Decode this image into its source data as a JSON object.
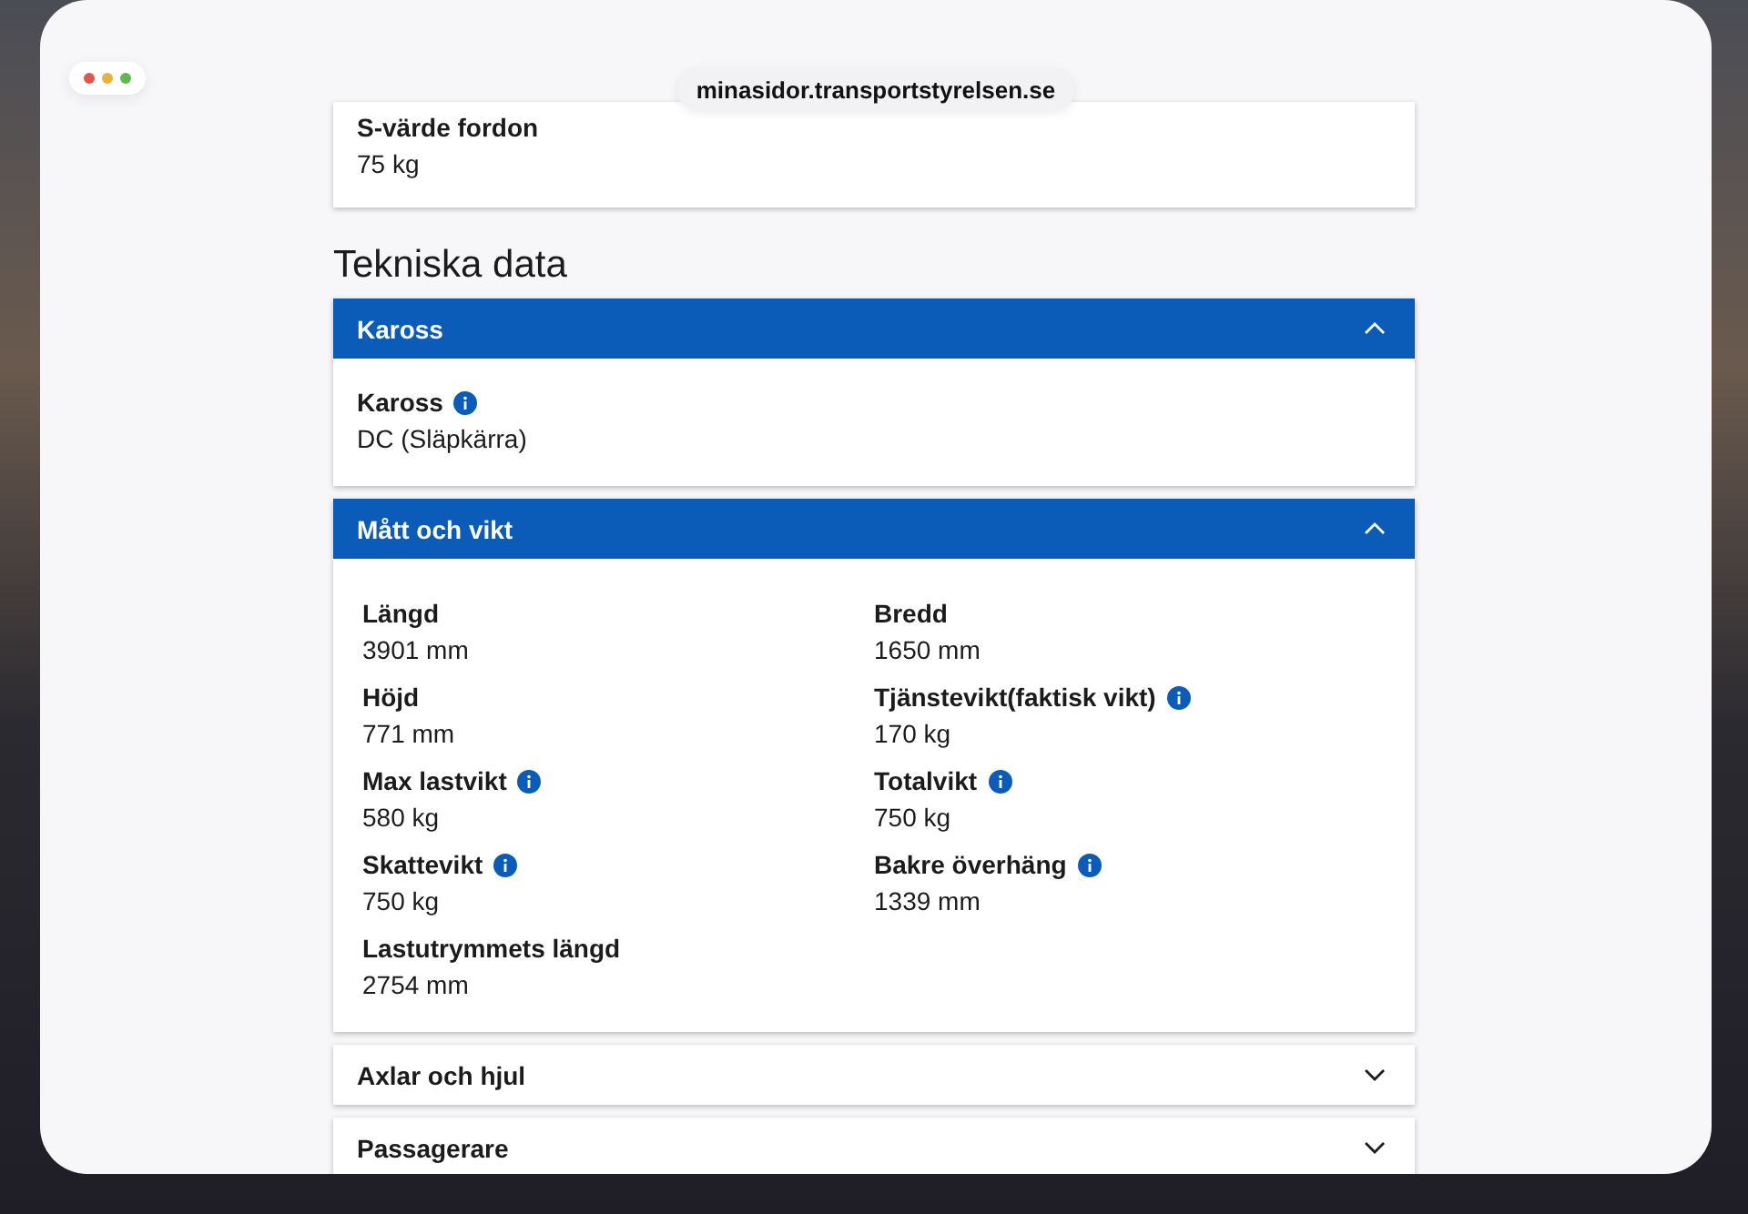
{
  "browser": {
    "url": "minasidor.transportstyrelsen.se"
  },
  "top_card": {
    "label": "S-värde fordon",
    "value": "75 kg"
  },
  "heading": "Tekniska data",
  "sections": [
    {
      "title": "Kaross",
      "expanded": true,
      "fields": [
        {
          "label": "Kaross",
          "info": true,
          "value": "DC (Släpkärra)"
        }
      ]
    },
    {
      "title": "Mått och vikt",
      "expanded": true,
      "fields": [
        {
          "label": "Längd",
          "info": false,
          "value": "3901 mm"
        },
        {
          "label": "Bredd",
          "info": false,
          "value": "1650 mm"
        },
        {
          "label": "Höjd",
          "info": false,
          "value": "771 mm"
        },
        {
          "label": "Tjänstevikt(faktisk vikt)",
          "info": true,
          "value": "170 kg"
        },
        {
          "label": "Max lastvikt",
          "info": true,
          "value": "580 kg"
        },
        {
          "label": "Totalvikt",
          "info": true,
          "value": "750 kg"
        },
        {
          "label": "Skattevikt",
          "info": true,
          "value": "750 kg"
        },
        {
          "label": "Bakre överhäng",
          "info": true,
          "value": "1339 mm"
        },
        {
          "label": "Lastutrymmets längd",
          "info": false,
          "value": "2754 mm"
        }
      ]
    },
    {
      "title": "Axlar och hjul",
      "expanded": false
    },
    {
      "title": "Passagerare",
      "expanded": false
    }
  ]
}
